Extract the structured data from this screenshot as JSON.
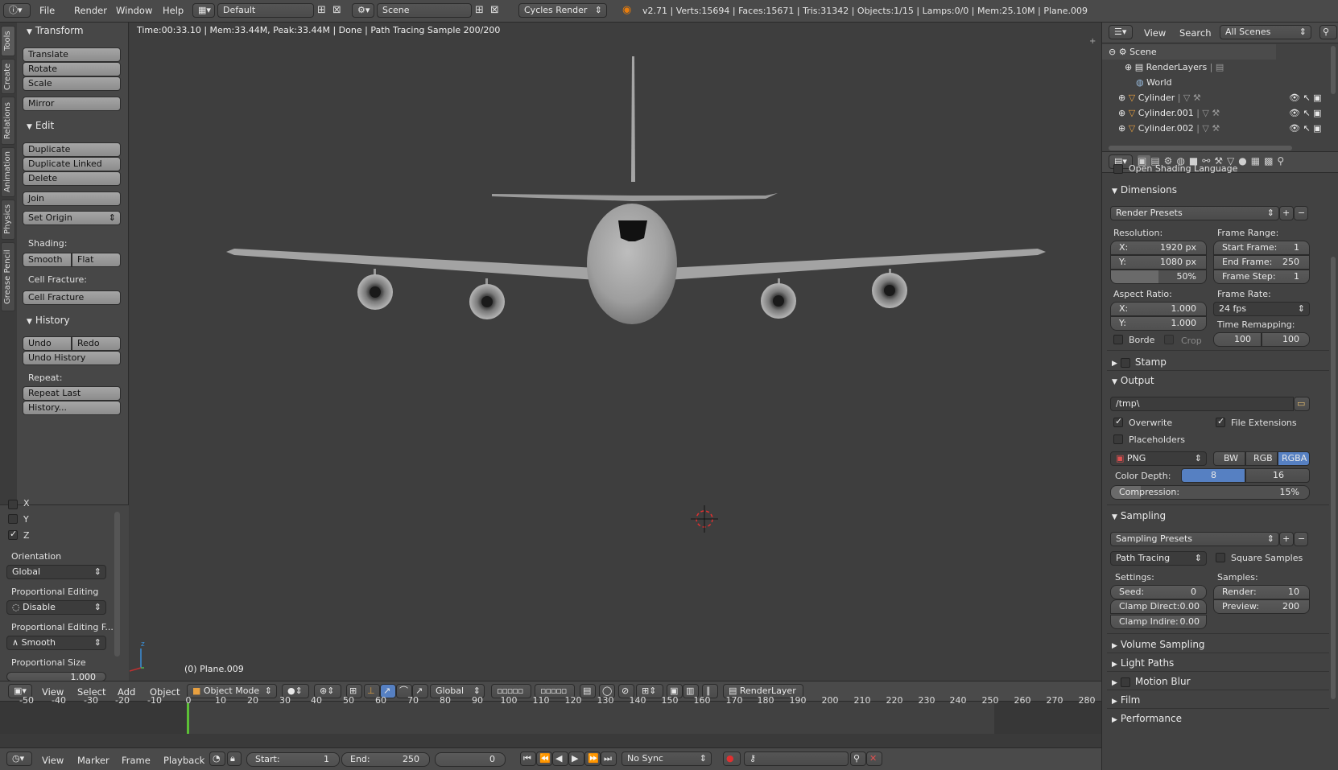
{
  "topbar": {
    "menus": [
      "File",
      "Render",
      "Window",
      "Help"
    ],
    "screen_layout": "Default",
    "scene": "Scene",
    "engine": "Cycles Render",
    "stats": "v2.71 | Verts:15694 | Faces:15671 | Tris:31342 | Objects:1/15 | Lamps:0/0 | Mem:25.10M | Plane.009"
  },
  "tools": {
    "vtabs": [
      "Tools",
      "Create",
      "Relations",
      "Animation",
      "Physics",
      "Grease Pencil"
    ],
    "transform_header": "Transform",
    "translate": "Translate",
    "rotate": "Rotate",
    "scale": "Scale",
    "mirror": "Mirror",
    "edit_header": "Edit",
    "duplicate": "Duplicate",
    "duplicate_linked": "Duplicate Linked",
    "delete": "Delete",
    "join": "Join",
    "set_origin": "Set Origin",
    "shading_label": "Shading:",
    "smooth": "Smooth",
    "flat": "Flat",
    "cell_fracture_label": "Cell Fracture:",
    "cell_fracture": "Cell Fracture",
    "history_header": "History",
    "undo": "Undo",
    "redo": "Redo",
    "undo_history": "Undo History",
    "repeat_label": "Repeat:",
    "repeat_last": "Repeat Last",
    "history_btn": "History..."
  },
  "operator": {
    "x_label": "X",
    "y_label": "Y",
    "z_label": "Z",
    "orientation_label": "Orientation",
    "orientation_value": "Global",
    "prop_edit_label": "Proportional Editing",
    "prop_edit_value": "Disable",
    "prop_falloff_label": "Proportional Editing F...",
    "prop_falloff_value": "Smooth",
    "prop_size_label": "Proportional Size",
    "prop_size_value": "1.000"
  },
  "viewport": {
    "render_info": "Time:00:33.10 | Mem:33.44M, Peak:33.44M | Done | Path Tracing Sample 200/200",
    "object_name": "(0) Plane.009",
    "header_menus": [
      "View",
      "Select",
      "Add",
      "Object"
    ],
    "mode": "Object Mode",
    "orientation": "Global",
    "render_layer": "RenderLayer"
  },
  "outliner": {
    "menus": [
      "View",
      "Search"
    ],
    "filter": "All Scenes",
    "items": [
      "Scene",
      "RenderLayers",
      "World",
      "Cylinder",
      "Cylinder.001",
      "Cylinder.002"
    ]
  },
  "properties": {
    "osl": "Open Shading Language",
    "dimensions_header": "Dimensions",
    "render_presets": "Render Presets",
    "resolution_label": "Resolution:",
    "res_x_label": "X:",
    "res_x": "1920 px",
    "res_y_label": "Y:",
    "res_y": "1080 px",
    "res_pct": "50%",
    "frame_range_label": "Frame Range:",
    "start_label": "Start Frame:",
    "start": "1",
    "end_label": "End Frame:",
    "end": "250",
    "step_label": "Frame Step:",
    "step": "1",
    "aspect_label": "Aspect Ratio:",
    "asp_x_label": "X:",
    "asp_x": "1.000",
    "asp_y_label": "Y:",
    "asp_y": "1.000",
    "frame_rate_label": "Frame Rate:",
    "frame_rate": "24 fps",
    "time_remap_label": "Time Remapping:",
    "remap_old": "100",
    "remap_new": "100",
    "border": "Borde",
    "crop": "Crop",
    "stamp_header": "Stamp",
    "output_header": "Output",
    "output_path": "/tmp\\",
    "overwrite": "Overwrite",
    "file_ext": "File Extensions",
    "placeholders": "Placeholders",
    "format": "PNG",
    "bw": "BW",
    "rgb": "RGB",
    "rgba": "RGBA",
    "color_depth_label": "Color Depth:",
    "depth8": "8",
    "depth16": "16",
    "compression_label": "Compression:",
    "compression": "15%",
    "sampling_header": "Sampling",
    "sampling_presets": "Sampling Presets",
    "integrator": "Path Tracing",
    "square_samples": "Square Samples",
    "settings_label": "Settings:",
    "seed_label": "Seed:",
    "seed": "0",
    "clamp_direct_label": "Clamp Direct:",
    "clamp_direct": "0.00",
    "clamp_indirect_label": "Clamp Indire:",
    "clamp_indirect": "0.00",
    "samples_label": "Samples:",
    "render_label": "Render:",
    "render_samples": "10",
    "preview_label": "Preview:",
    "preview_samples": "200",
    "volume_header": "Volume Sampling",
    "light_paths_header": "Light Paths",
    "motion_blur_header": "Motion Blur",
    "film_header": "Film",
    "performance_header": "Performance"
  },
  "timeline": {
    "ticks": [
      "-50",
      "-40",
      "-30",
      "-20",
      "-10",
      "0",
      "10",
      "20",
      "30",
      "40",
      "50",
      "60",
      "70",
      "80",
      "90",
      "100",
      "110",
      "120",
      "130",
      "140",
      "150",
      "160",
      "170",
      "180",
      "190",
      "200",
      "210",
      "220",
      "230",
      "240",
      "250",
      "260",
      "270",
      "280"
    ],
    "menus": [
      "View",
      "Marker",
      "Frame",
      "Playback"
    ],
    "start_label": "Start:",
    "start": "1",
    "end_label": "End:",
    "end": "250",
    "current": "0",
    "sync": "No Sync"
  }
}
